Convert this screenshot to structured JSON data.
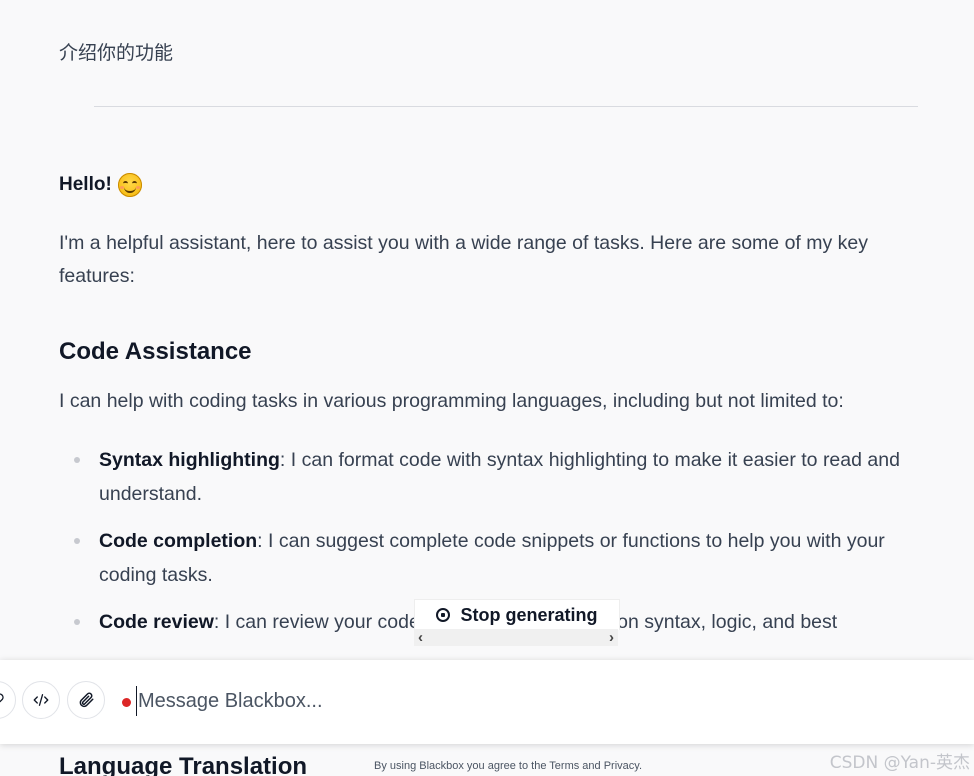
{
  "conversation": {
    "user_message": "介绍你的功能",
    "assistant": {
      "greeting": "Hello!",
      "greeting_emoji": "smiling-face-icon",
      "intro": "I'm a helpful assistant, here to assist you with a wide range of tasks. Here are some of my key features:",
      "section1_title": "Code Assistance",
      "section1_intro": "I can help with coding tasks in various programming languages, including but not limited to:",
      "features": [
        {
          "title": "Syntax highlighting",
          "desc": ": I can format code with syntax highlighting to make it easier to read and understand."
        },
        {
          "title": "Code completion",
          "desc": ": I can suggest complete code snippets or functions to help you with your coding tasks."
        },
        {
          "title": "Code review",
          "desc": ": I can review your code and provide feedback on syntax, logic, and best"
        }
      ],
      "section2_title": "Language Translation"
    }
  },
  "stop_button": {
    "label": "Stop generating"
  },
  "scrollbar": {
    "left": "‹",
    "right": "›"
  },
  "composer": {
    "placeholder": "Message Blackbox...",
    "buttons": [
      "link-icon",
      "code-icon",
      "paperclip-icon"
    ]
  },
  "footer": {
    "terms": "By using Blackbox you agree to the Terms and Privacy."
  },
  "watermark": "CSDN @Yan-英杰",
  "colors": {
    "background": "#f9f9fa",
    "text": "#374151",
    "heading": "#111827",
    "record_dot": "#dc2626"
  }
}
